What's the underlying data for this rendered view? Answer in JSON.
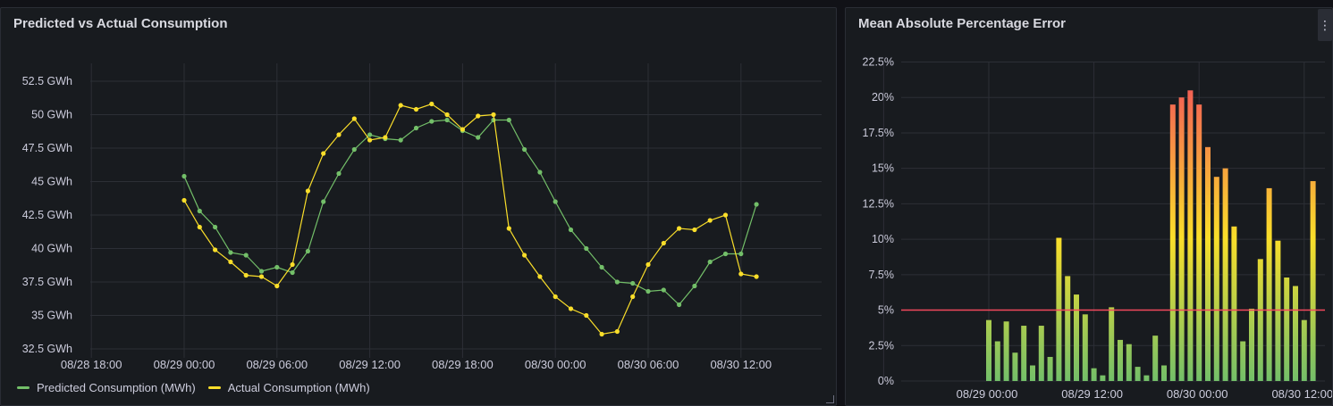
{
  "colors": {
    "background": "#111217",
    "panel": "#181b1f",
    "grid": "#2c2f36",
    "predicted": "#73bf69",
    "actual": "#fade2a",
    "threshold": "#f2495c"
  },
  "panels": {
    "left": {
      "title": "Predicted vs Actual Consumption"
    },
    "right": {
      "title": "Mean Absolute Percentage Error",
      "menu_icon": "ellipsis-vertical-icon"
    }
  },
  "chart_data": [
    {
      "type": "line",
      "title": "Predicted vs Actual Consumption",
      "x_ticks": [
        "08/28 18:00",
        "08/29 00:00",
        "08/29 06:00",
        "08/29 12:00",
        "08/29 18:00",
        "08/30 00:00",
        "08/30 06:00",
        "08/30 12:00"
      ],
      "x_range_hours": [
        -7.5,
        41
      ],
      "y_ticks": [
        "32.5 GWh",
        "35 GWh",
        "37.5 GWh",
        "40 GWh",
        "42.5 GWh",
        "45 GWh",
        "47.5 GWh",
        "50 GWh",
        "52.5 GWh"
      ],
      "ylim": [
        31,
        53.5
      ],
      "legend": [
        "Predicted Consumption (MWh)",
        "Actual Consumption (MWh)"
      ],
      "legend_position": "bottom-left",
      "x_hours": [
        0,
        1,
        2,
        3,
        4,
        5,
        6,
        7,
        8,
        9,
        10,
        11,
        12,
        13,
        14,
        15,
        16,
        17,
        18,
        19,
        20,
        21,
        22,
        23,
        24,
        25,
        26,
        27,
        28,
        29,
        30,
        31,
        32,
        33,
        34,
        35,
        36,
        37
      ],
      "series": [
        {
          "name": "Predicted Consumption (MWh)",
          "color": "#73bf69",
          "values": [
            45.4,
            42.8,
            41.6,
            39.7,
            39.5,
            38.3,
            38.6,
            38.2,
            39.8,
            43.5,
            45.6,
            47.4,
            48.5,
            48.2,
            48.1,
            49.0,
            49.5,
            49.6,
            48.8,
            48.3,
            49.6,
            49.6,
            47.4,
            45.7,
            43.5,
            41.4,
            40.0,
            38.6,
            37.5,
            37.4,
            36.8,
            36.9,
            35.8,
            37.2,
            39.0,
            39.6,
            39.6,
            43.3
          ]
        },
        {
          "name": "Actual Consumption (MWh)",
          "color": "#fade2a",
          "values": [
            43.6,
            41.6,
            39.9,
            39.0,
            38.0,
            37.9,
            37.2,
            38.8,
            44.3,
            47.1,
            48.5,
            49.7,
            48.1,
            48.3,
            50.7,
            50.4,
            50.8,
            50.0,
            48.9,
            49.9,
            50.0,
            41.5,
            39.5,
            37.9,
            36.4,
            35.5,
            35.0,
            33.6,
            33.8,
            36.4,
            38.8,
            40.4,
            41.5,
            41.4,
            42.1,
            42.5,
            38.1,
            37.9
          ]
        }
      ]
    },
    {
      "type": "bar",
      "title": "Mean Absolute Percentage Error",
      "x_ticks": [
        "08/29 00:00",
        "08/29 12:00",
        "08/30 00:00",
        "08/30 12:00"
      ],
      "y_ticks": [
        "0%",
        "2.5%",
        "5%",
        "7.5%",
        "10%",
        "12.5%",
        "15%",
        "17.5%",
        "20%",
        "22.5%"
      ],
      "ylim": [
        0,
        22.5
      ],
      "threshold": 5,
      "threshold_color": "#f2495c",
      "color_scheme": "green-yellow-red by value",
      "values": [
        4.3,
        2.8,
        4.2,
        2.0,
        3.9,
        1.1,
        3.9,
        1.7,
        10.1,
        7.4,
        6.1,
        4.7,
        0.9,
        0.4,
        5.2,
        2.9,
        2.6,
        1.0,
        0.4,
        3.2,
        1.1,
        19.5,
        20.0,
        20.5,
        19.5,
        16.5,
        14.4,
        15.0,
        10.9,
        2.8,
        5.1,
        8.6,
        13.6,
        9.9,
        7.3,
        6.7,
        4.3,
        14.1
      ]
    }
  ]
}
